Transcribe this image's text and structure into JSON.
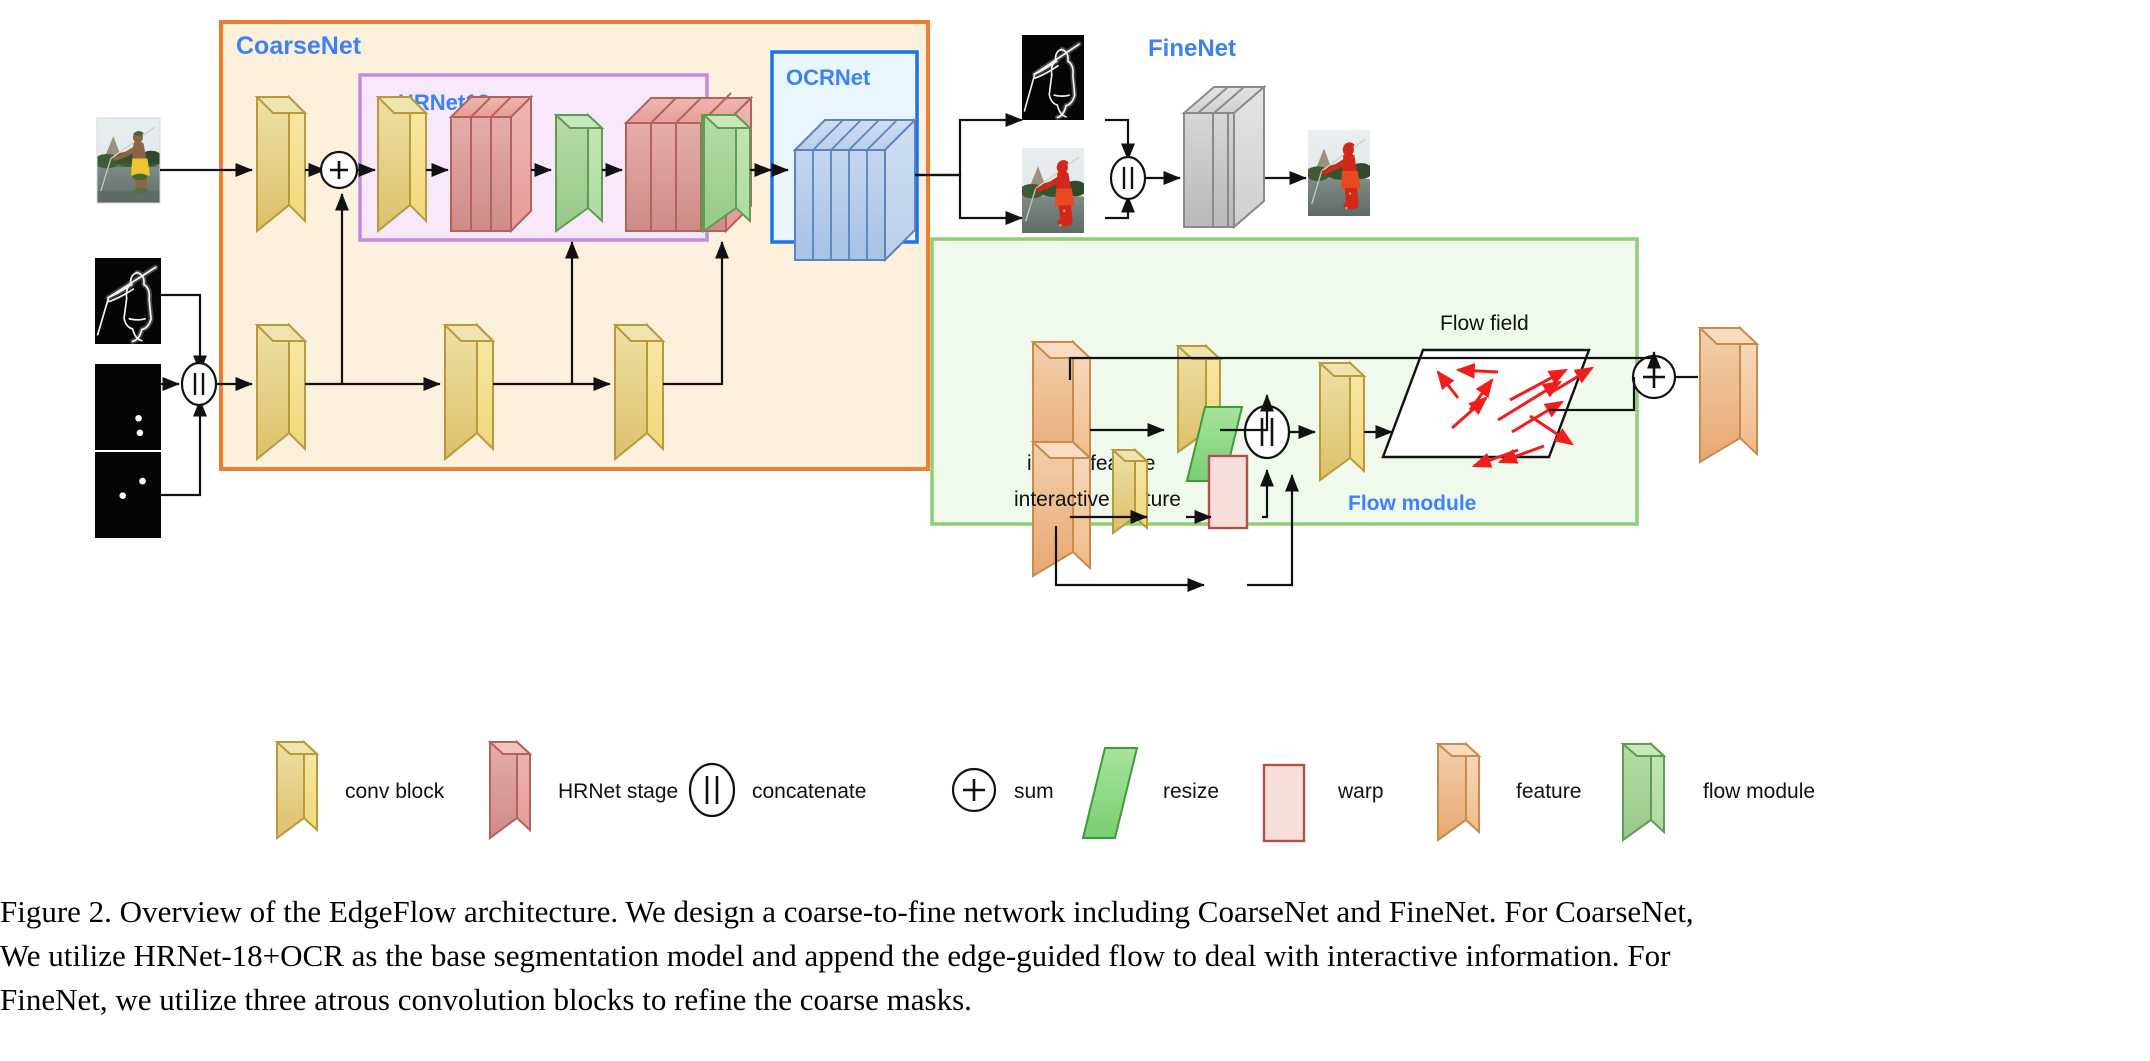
{
  "figure": {
    "panels": {
      "coarsenet": {
        "label": "CoarseNet",
        "border_color": "#ed7d31",
        "fill": "#fdf0dc"
      },
      "hrnet18": {
        "label": "HRNet18",
        "border_color": "#c08ae8",
        "fill": "#f9e8fb"
      },
      "ocrnet": {
        "label": "OCRNet",
        "border_color": "#1a73e8",
        "fill": "#eaf6fe"
      },
      "finenet": {
        "label": "FineNet"
      },
      "flowmodule": {
        "label": "Flow module",
        "border_color": "#8fcf74",
        "fill": "#effaec"
      }
    },
    "flow_module": {
      "image_feature_label": "image feature",
      "interactive_feature_label": "interactive feature",
      "flow_field_label": "Flow field",
      "arrow_color": "#f01d1d"
    },
    "nodes": {
      "concat_glyph": "||",
      "sum_glyph": "+"
    },
    "inputs": [
      {
        "name": "rgb-image",
        "desc": "RGB photo of person wading in water"
      },
      {
        "name": "edge-map",
        "desc": "grayscale edge/boundary map"
      },
      {
        "name": "negative-clicks",
        "desc": "black map with two white dots"
      },
      {
        "name": "positive-clicks",
        "desc": "black map with two white dots"
      }
    ],
    "outputs": [
      {
        "name": "coarse-edge-map",
        "desc": "grayscale edge map"
      },
      {
        "name": "coarse-mask",
        "desc": "photo with red segmentation mask"
      },
      {
        "name": "fine-mask",
        "desc": "photo with refined red segmentation mask"
      }
    ],
    "legend": [
      {
        "label": "conv block",
        "icon": "conv-block-icon",
        "color": "#f0d77e"
      },
      {
        "label": "HRNet stage",
        "icon": "hrnet-stage-icon",
        "color": "#e08e8e"
      },
      {
        "label": "concatenate",
        "icon": "concat-icon",
        "color": "#000000"
      },
      {
        "label": "sum",
        "icon": "sum-icon",
        "color": "#000000"
      },
      {
        "label": "resize",
        "icon": "resize-icon",
        "color": "#8ede8c"
      },
      {
        "label": "warp",
        "icon": "warp-icon",
        "color": "#f8dedb"
      },
      {
        "label": "feature",
        "icon": "feature-icon",
        "color": "#f3b989"
      },
      {
        "label": "flow module",
        "icon": "flow-module-icon",
        "color": "#a8d79a"
      }
    ],
    "caption": {
      "line1": "Figure 2. Overview of the EdgeFlow architecture. We design a coarse-to-fine network including CoarseNet and FineNet. For CoarseNet,",
      "line2": "We utilize HRNet-18+OCR as the base segmentation model and append the edge-guided flow to deal with interactive information. For",
      "line3": "FineNet, we utilize three atrous convolution blocks to refine the coarse masks."
    }
  }
}
